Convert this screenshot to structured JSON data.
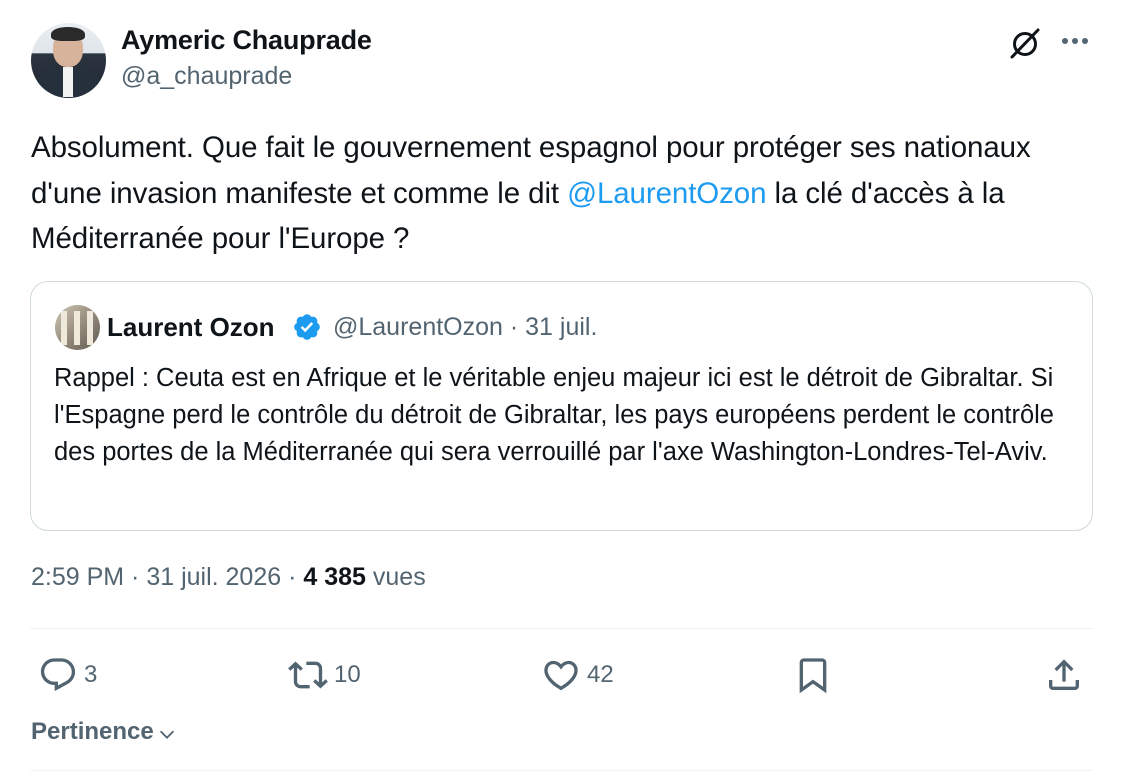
{
  "author": {
    "name": "Aymeric Chauprade",
    "handle": "@a_chauprade"
  },
  "tweet": {
    "text_before_mention": "Absolument. Que fait le gouvernement espagnol pour protéger ses nationaux d'une invasion manifeste et comme le  dit ",
    "mention": "@LaurentOzon",
    "text_after_mention": " la clé d'accès à la Méditerranée pour l'Europe ?"
  },
  "quote": {
    "name": "Laurent Ozon",
    "handle_date": "@LaurentOzon · 31 juil.",
    "text": "Rappel : Ceuta est en Afrique et le véritable enjeu majeur ici est le détroit de Gibraltar. Si l'Espagne perd le contrôle du détroit de Gibraltar, les pays européens perdent le contrôle des portes de la Méditerranée qui sera verrouillé par l'axe Washington-Londres-Tel-Aviv."
  },
  "meta": {
    "time_date": "2:59 PM · 31 juil. 2026 · ",
    "views_count": "4 385",
    "views_label": " vues"
  },
  "actions": {
    "replies": "3",
    "reposts": "10",
    "likes": "42"
  },
  "sort": {
    "label": "Pertinence"
  },
  "colors": {
    "accent": "#1d9bf0",
    "secondary_text": "#536471",
    "border": "#cfd9de"
  }
}
